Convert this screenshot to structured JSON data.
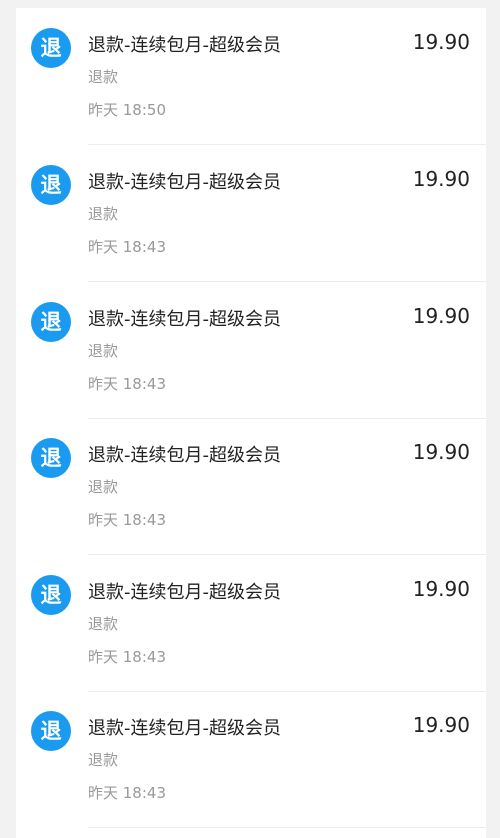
{
  "transactions": [
    {
      "icon_label": "退",
      "title": "退款-连续包月-超级会员",
      "type": "退款",
      "time": "昨天 18:50",
      "amount": "19.90"
    },
    {
      "icon_label": "退",
      "title": "退款-连续包月-超级会员",
      "type": "退款",
      "time": "昨天 18:43",
      "amount": "19.90"
    },
    {
      "icon_label": "退",
      "title": "退款-连续包月-超级会员",
      "type": "退款",
      "time": "昨天 18:43",
      "amount": "19.90"
    },
    {
      "icon_label": "退",
      "title": "退款-连续包月-超级会员",
      "type": "退款",
      "time": "昨天 18:43",
      "amount": "19.90"
    },
    {
      "icon_label": "退",
      "title": "退款-连续包月-超级会员",
      "type": "退款",
      "time": "昨天 18:43",
      "amount": "19.90"
    },
    {
      "icon_label": "退",
      "title": "退款-连续包月-超级会员",
      "type": "退款",
      "time": "昨天 18:43",
      "amount": "19.90"
    }
  ],
  "colors": {
    "icon_background": "#1a9bf0",
    "primary_text": "#222222",
    "secondary_text": "#999999"
  }
}
